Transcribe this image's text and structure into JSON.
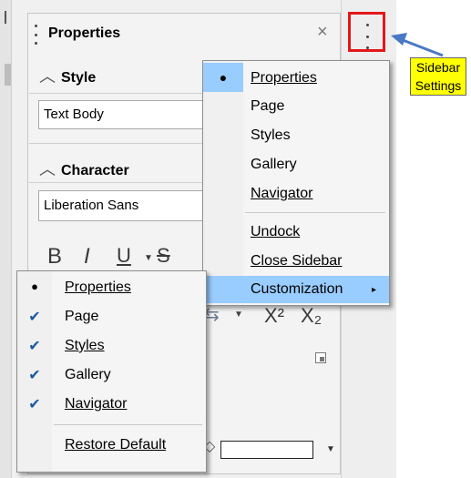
{
  "sidebar": {
    "title": "Properties",
    "style_section": {
      "heading": "Style",
      "value": "Text Body"
    },
    "character_section": {
      "heading": "Character",
      "font": "Liberation Sans"
    },
    "format_buttons": {
      "bold": "B",
      "italic": "I",
      "underline": "U",
      "strike": "S",
      "superscript": "X²",
      "subscript": "X₂"
    }
  },
  "callout": {
    "line1": "Sidebar",
    "line2": "Settings",
    "color": "#ffff05",
    "highlight_color": "#e31818"
  },
  "settings_menu": {
    "items": [
      {
        "label": "Properties",
        "mark": "●",
        "selected": true
      },
      {
        "label": "Page",
        "mark": ""
      },
      {
        "label": "Styles",
        "mark": ""
      },
      {
        "label": "Gallery",
        "mark": ""
      },
      {
        "label": "Navigator",
        "mark": ""
      },
      {
        "label": "Undock",
        "mark": ""
      },
      {
        "label": "Close Sidebar",
        "mark": ""
      },
      {
        "label": "Customization",
        "mark": "",
        "highlighted": true
      }
    ]
  },
  "customization_menu": {
    "items": [
      {
        "label": "Properties",
        "mark": "●"
      },
      {
        "label": "Page",
        "mark": "✔"
      },
      {
        "label": "Styles",
        "mark": "✔"
      },
      {
        "label": "Gallery",
        "mark": "✔"
      },
      {
        "label": "Navigator",
        "mark": "✔"
      },
      {
        "label": "Restore Default",
        "mark": ""
      }
    ]
  },
  "colors": {
    "menu_highlight": "#99ccff",
    "arrow": "#4a78c4"
  }
}
